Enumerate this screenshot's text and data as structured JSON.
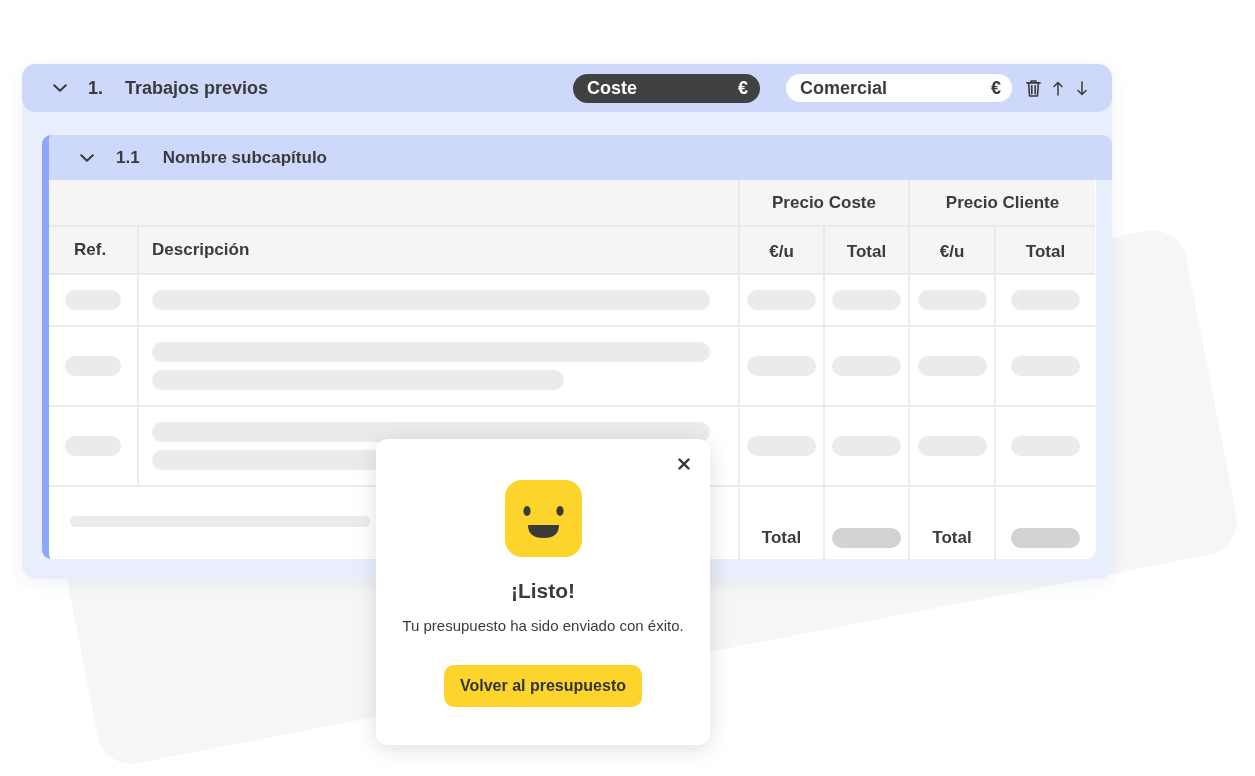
{
  "chapter": {
    "expanded": true,
    "number": "1.",
    "title": "Trabajos previos",
    "price_fields": [
      {
        "label": "Coste",
        "unit": "€",
        "selected": true
      },
      {
        "label": "Comercial",
        "unit": "€",
        "selected": false
      }
    ]
  },
  "subchapter": {
    "expanded": true,
    "number": "1.1",
    "title": "Nombre subcapítulo"
  },
  "table": {
    "column_groups": [
      "Precio Coste",
      "Precio Cliente"
    ],
    "columns": [
      "Ref.",
      "Descripción",
      "€/u",
      "Total",
      "€/u",
      "Total"
    ],
    "rows": [
      {
        "kind": "single"
      },
      {
        "kind": "double"
      },
      {
        "kind": "double"
      }
    ],
    "footer_labels": [
      "Total",
      "Total"
    ]
  },
  "dialog": {
    "title": "¡Listo!",
    "message": "Tu presupuesto ha sido enviado con éxito.",
    "button": "Volver al presupuesto"
  }
}
